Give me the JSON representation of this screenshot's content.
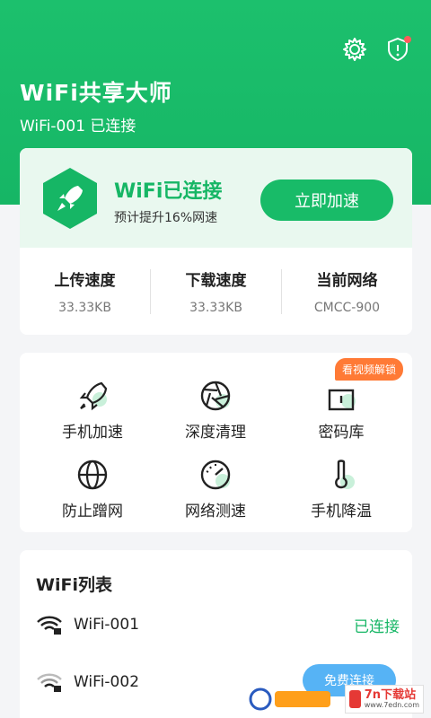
{
  "header": {
    "title": "WiFi共享大师",
    "connection": "WiFi-001 已连接"
  },
  "status_card": {
    "title": "WiFi已连接",
    "desc": "预计提升16%网速",
    "boost_label": "立即加速",
    "stats": [
      {
        "label": "上传速度",
        "value": "33.33KB"
      },
      {
        "label": "下载速度",
        "value": "33.33KB"
      },
      {
        "label": "当前网络",
        "value": "CMCC-900"
      }
    ]
  },
  "tools": {
    "items": [
      {
        "label": "手机加速",
        "icon": "rocket-icon"
      },
      {
        "label": "深度清理",
        "icon": "aperture-icon"
      },
      {
        "label": "密码库",
        "icon": "lock-box-icon"
      },
      {
        "label": "防止蹭网",
        "icon": "globe-icon"
      },
      {
        "label": "网络测速",
        "icon": "speedometer-icon"
      },
      {
        "label": "手机降温",
        "icon": "thermometer-icon"
      }
    ],
    "badge": "看视频解锁"
  },
  "wifi_list": {
    "title": "WiFi列表",
    "items": [
      {
        "name": "WiFi-001",
        "status": "已连接"
      },
      {
        "name": "WiFi-002",
        "status": ""
      }
    ],
    "connect_label": "免费连接"
  },
  "watermark": {
    "brand": "7n下载站",
    "url": "www.7edn.com"
  },
  "colors": {
    "primary": "#16b665",
    "badge": "#ff7a36",
    "connect": "#56b3f5"
  }
}
